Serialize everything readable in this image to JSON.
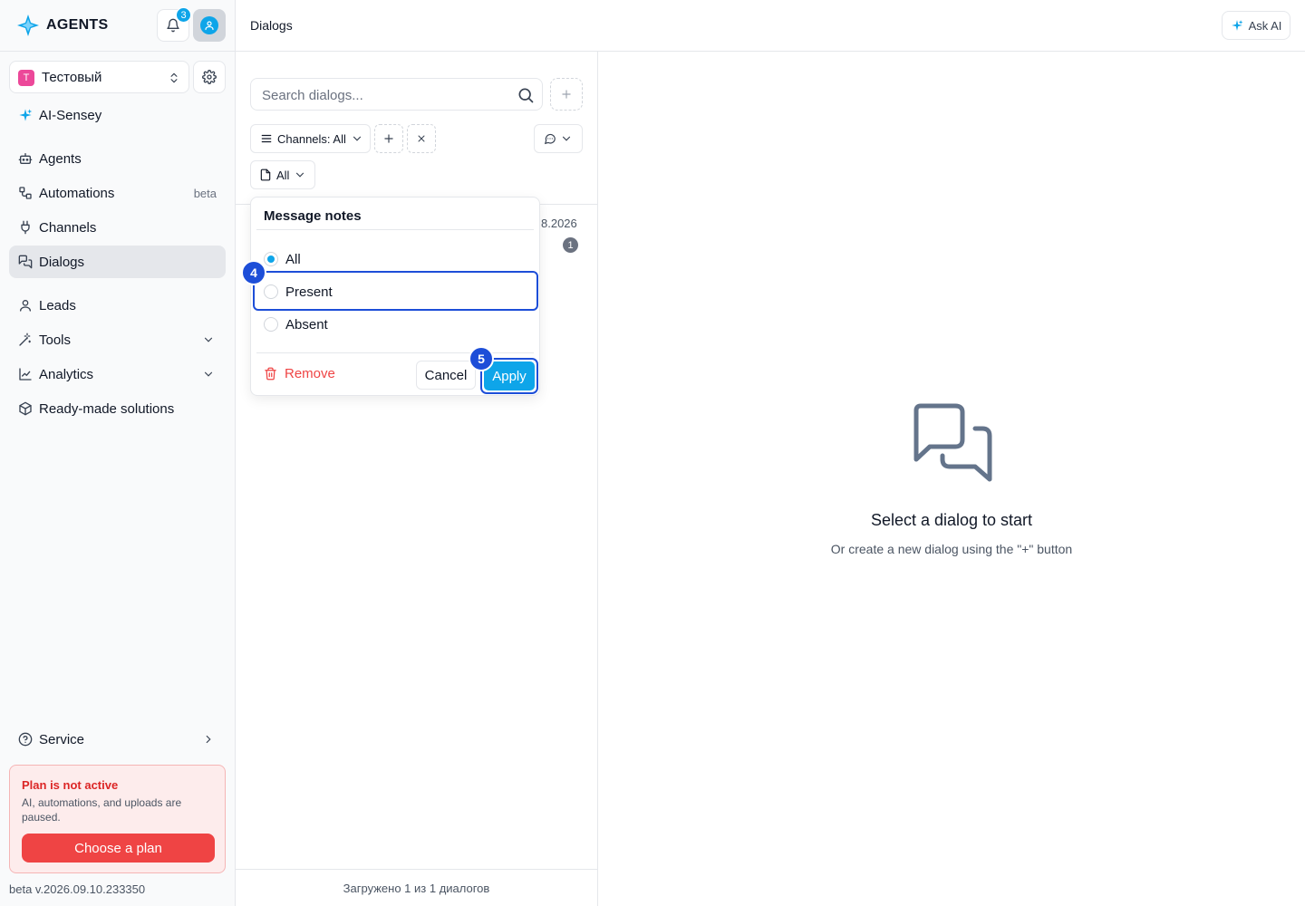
{
  "brand": {
    "name": "AGENTS",
    "accent": "#0ea5e9"
  },
  "header": {
    "notifications_count": "3",
    "page_title": "Dialogs",
    "ask_ai_label": "Ask AI"
  },
  "workspace": {
    "initial": "T",
    "name": "Тестовый"
  },
  "sidebar": {
    "items": [
      {
        "label": "AI-Sensey",
        "icon": "sparkle-icon"
      },
      {
        "label": "Agents",
        "icon": "bot-icon"
      },
      {
        "label": "Automations",
        "icon": "workflow-icon",
        "tag": "beta"
      },
      {
        "label": "Channels",
        "icon": "plug-icon"
      },
      {
        "label": "Dialogs",
        "icon": "chat-icon",
        "active": true
      },
      {
        "label": "Leads",
        "icon": "user-icon"
      },
      {
        "label": "Tools",
        "icon": "wand-icon"
      },
      {
        "label": "Analytics",
        "icon": "chart-icon"
      },
      {
        "label": "Ready-made solutions",
        "icon": "package-icon"
      }
    ],
    "service_label": "Service"
  },
  "plan": {
    "title": "Plan is not active",
    "description": "AI, automations, and uploads are paused.",
    "button": "Choose a plan",
    "color": "#ef4444"
  },
  "version": "beta v.2026.09.10.233350",
  "dialogs": {
    "search_placeholder": "Search dialogs...",
    "channels_filter": "Channels: All",
    "notes_filter": "All",
    "item_date": "8.2026",
    "item_unread": "1",
    "footer": "Загружено 1 из 1 диалогов"
  },
  "popover": {
    "title": "Message notes",
    "options": [
      "All",
      "Present",
      "Absent"
    ],
    "selected": "All",
    "remove_label": "Remove",
    "cancel_label": "Cancel",
    "apply_label": "Apply"
  },
  "steps": {
    "highlight_option": "4",
    "apply": "5"
  },
  "empty_state": {
    "title": "Select a dialog to start",
    "subtitle": "Or create a new dialog using the \"+\" button"
  }
}
